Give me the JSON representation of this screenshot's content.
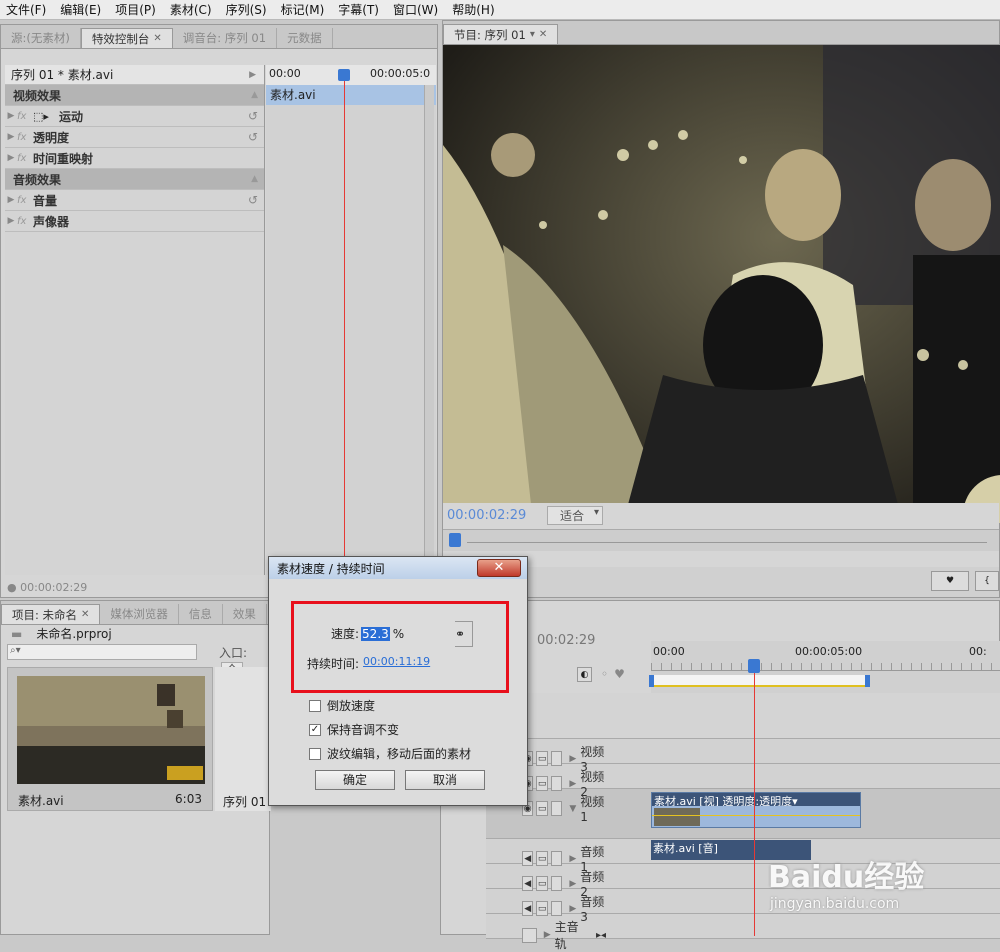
{
  "menu": [
    "文件(F)",
    "编辑(E)",
    "项目(P)",
    "素材(C)",
    "序列(S)",
    "标记(M)",
    "字幕(T)",
    "窗口(W)",
    "帮助(H)"
  ],
  "source_panel": {
    "tabs": [
      "源:(无素材)",
      "特效控制台",
      "调音台: 序列 01",
      "元数据"
    ],
    "clip_header": "序列 01 * 素材.avi",
    "ruler_start": "00:00",
    "ruler_end": "00:00:05:0",
    "clip_bar": "素材.avi",
    "video_effects": "视频效果",
    "motion": "运动",
    "opacity": "透明度",
    "time_remap": "时间重映射",
    "audio_effects": "音频效果",
    "volume": "音量",
    "panner": "声像器",
    "timecode": "00:00:02:29"
  },
  "program_panel": {
    "tab": "节目: 序列 01",
    "timecode": "00:00:02:29",
    "fit": "适合"
  },
  "project_panel": {
    "tabs": [
      "项目: 未命名",
      "媒体浏览器",
      "信息",
      "效果"
    ],
    "project_file": "未命名.prproj",
    "in_label": "入口:",
    "in_value": "全",
    "item_name": "素材.avi",
    "item_duration": "6:03",
    "item2_name": "序列 01"
  },
  "timeline": {
    "timecode": "00:02:29",
    "ruler": [
      "00:00",
      "00:00:05:00",
      "00:"
    ],
    "tracks": [
      "视频 3",
      "视频 2",
      "视频 1",
      "音频 1",
      "音频 2",
      "音频 3",
      "主音轨"
    ],
    "video_clip_label": "素材.avi [视] 透明度:透明度▾",
    "audio_clip_label": "素材.avi [音]"
  },
  "dialog": {
    "title": "素材速度 / 持续时间",
    "close": "✕",
    "speed_label": "速度:",
    "speed_value": "52.3",
    "speed_unit": "%",
    "duration_label": "持续时间:",
    "duration_value": "00:00:11:19",
    "reverse": "倒放速度",
    "maintain_pitch": "保持音调不变",
    "ripple": "波纹编辑，移动后面的素材",
    "ok": "确定",
    "cancel": "取消",
    "reverse_checked": false,
    "pitch_checked": true,
    "ripple_checked": false
  },
  "watermark": {
    "brand": "Baidu经验",
    "url": "jingyan.baidu.com"
  },
  "colors": {
    "playhead": "#e53935",
    "highlight": "#e8101c",
    "clip_video": "#9db8dc",
    "clip_audio": "#3c5478",
    "accent": "#2a6ed6"
  }
}
